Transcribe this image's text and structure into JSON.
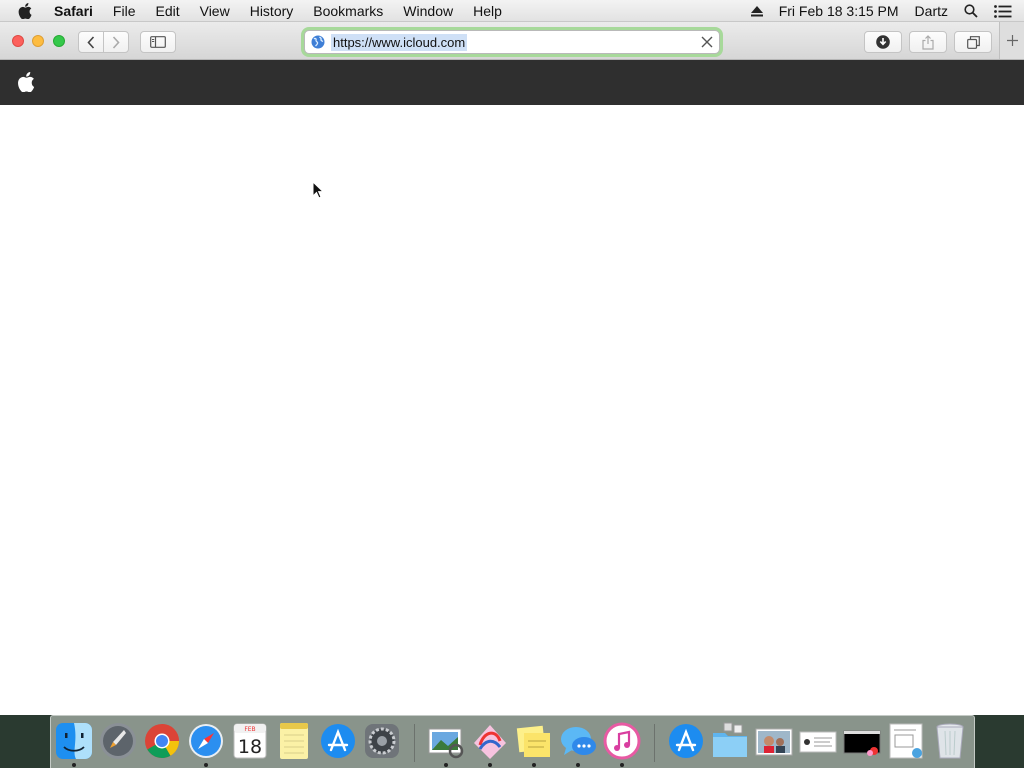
{
  "menubar": {
    "app_name": "Safari",
    "items": [
      "File",
      "Edit",
      "View",
      "History",
      "Bookmarks",
      "Window",
      "Help"
    ],
    "datetime": "Fri Feb 18  3:15 PM",
    "user": "Dartz"
  },
  "toolbar": {
    "address": "https://www.icloud.com"
  },
  "dock": {
    "calendar_month": "FEB",
    "calendar_day": "18",
    "items": [
      "finder-icon",
      "launchpad-icon",
      "chrome-icon",
      "safari-icon",
      "calendar-icon",
      "notes-icon",
      "app-store-icon",
      "system-preferences-icon",
      "preview-icon",
      "grapher-icon",
      "stickies-icon",
      "messages-icon",
      "itunes-icon",
      "app-store-folder-icon",
      "folder-icon",
      "photo-icon",
      "document-icon",
      "terminal-window-icon",
      "screenshot-icon",
      "trash-icon"
    ]
  },
  "colors": {
    "address_focus_ring": "#a7d99a",
    "site_header": "#2f2f2f"
  }
}
